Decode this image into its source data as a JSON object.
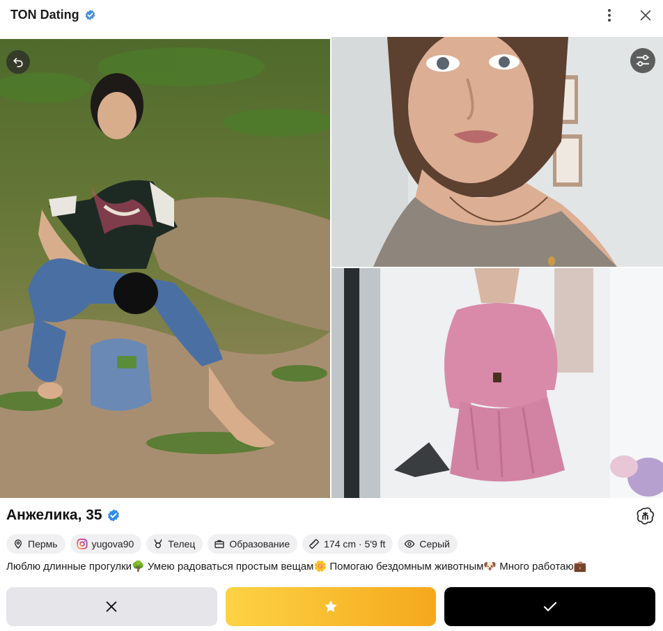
{
  "app": {
    "title": "TON Dating"
  },
  "profile": {
    "name_age": "Анжелика, 35",
    "chips": {
      "city": "Пермь",
      "instagram": "yugova90",
      "zodiac": "Телец",
      "education": "Образование",
      "height": "174 cm · 5'9 ft",
      "eyes": "Серый"
    },
    "bio": "Люблю длинные прогулки🌳 Умею радоваться простым вещам🌼 Помогаю бездомным животным🐶 Много работаю💼"
  },
  "colors": {
    "verified": "#2f8cf0",
    "superlike_start": "#fdd345",
    "superlike_end": "#f5a81c",
    "like": "#000000",
    "dislike": "#e5e5ea"
  },
  "icons": {
    "title_badge": "verified-badge-icon",
    "menu": "kebab-menu-icon",
    "close": "close-icon",
    "undo": "undo-icon",
    "filters": "filter-sliders-icon",
    "ai": "openai-icon",
    "dislike": "x-icon",
    "superlike": "star-icon",
    "like": "check-icon"
  }
}
